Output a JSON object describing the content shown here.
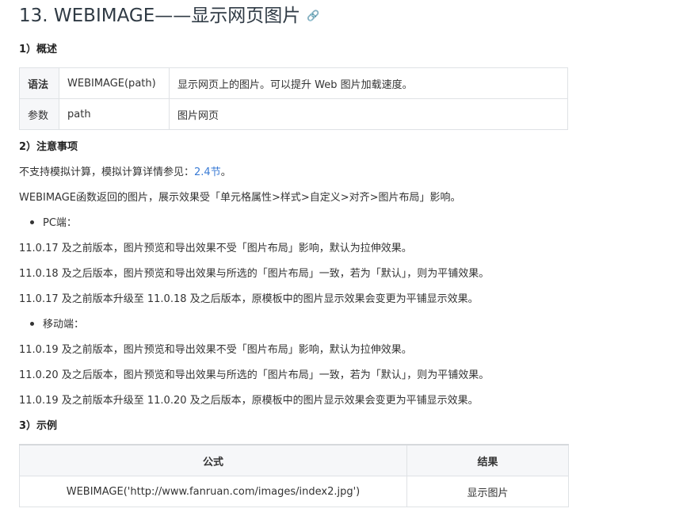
{
  "title": {
    "text": "13. WEBIMAGE——显示网页图片",
    "link_icon": "🔗"
  },
  "sections": {
    "overview_heading": "1）概述",
    "notes_heading": "2）注意事项",
    "example_heading": "3）示例"
  },
  "syntax_table": {
    "rows": [
      {
        "key": "语法",
        "name": "WEBIMAGE(path)",
        "desc": "显示网页上的图片。可以提升 Web 图片加载速度。"
      },
      {
        "key": "参数",
        "name": "path",
        "desc": "图片网页"
      }
    ]
  },
  "notes": {
    "line1_prefix": "不支持模拟计算，模拟计算详情参见：",
    "line1_link": "2.4节",
    "line1_suffix": "。",
    "line2": "WEBIMAGE函数返回的图片，展示效果受「单元格属性>样式>自定义>对齐>图片布局」影响。",
    "pc_label": "PC端：",
    "pc_lines": [
      "11.0.17 及之前版本，图片预览和导出效果不受「图片布局」影响，默认为拉伸效果。",
      "11.0.18 及之后版本，图片预览和导出效果与所选的「图片布局」一致，若为「默认」，则为平铺效果。",
      "11.0.17 及之前版本升级至 11.0.18 及之后版本，原模板中的图片显示效果会变更为平铺显示效果。"
    ],
    "mobile_label": "移动端：",
    "mobile_lines": [
      "11.0.19 及之前版本，图片预览和导出效果不受「图片布局」影响，默认为拉伸效果。",
      "11.0.20 及之后版本，图片预览和导出效果与所选的「图片布局」一致，若为「默认」，则为平铺效果。",
      "11.0.19 及之前版本升级至 11.0.20 及之后版本，原模板中的图片显示效果会变更为平铺显示效果。"
    ]
  },
  "example_table": {
    "headers": [
      "公式",
      "结果"
    ],
    "rows": [
      {
        "formula": "WEBIMAGE('http://www.fanruan.com/images/index2.jpg')",
        "result": "显示图片"
      }
    ]
  },
  "colors": {
    "link": "#3a7bd5",
    "title": "#2f3a44",
    "table_border": "#dfe2e5",
    "table_header_bg": "#f6f7f9"
  }
}
